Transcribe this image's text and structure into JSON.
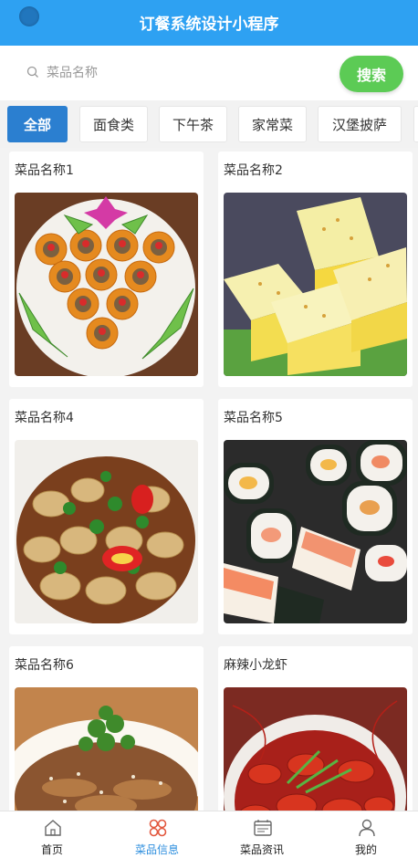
{
  "header": {
    "title": "订餐系统设计小程序"
  },
  "search": {
    "placeholder": "菜品名称",
    "button_label": "搜索"
  },
  "categories": [
    "全部",
    "面食类",
    "下午茶",
    "家常菜",
    "汉堡披萨"
  ],
  "active_category": "全部",
  "dishes": [
    {
      "name": "菜品名称1"
    },
    {
      "name": "菜品名称2"
    },
    {
      "name": "菜品名称4"
    },
    {
      "name": "菜品名称5"
    },
    {
      "name": "菜品名称6"
    },
    {
      "name": "麻辣小龙虾"
    }
  ],
  "tabbar": [
    {
      "label": "首页",
      "icon": "home-icon"
    },
    {
      "label": "菜品信息",
      "icon": "dish-info-icon"
    },
    {
      "label": "菜品资讯",
      "icon": "news-icon"
    },
    {
      "label": "我的",
      "icon": "user-icon"
    }
  ],
  "active_tab": "菜品信息",
  "colors": {
    "header": "#2ea1f2",
    "search_button": "#5ccb55",
    "active_category": "#2b7fd0",
    "active_tab_text": "#2c8ede"
  }
}
